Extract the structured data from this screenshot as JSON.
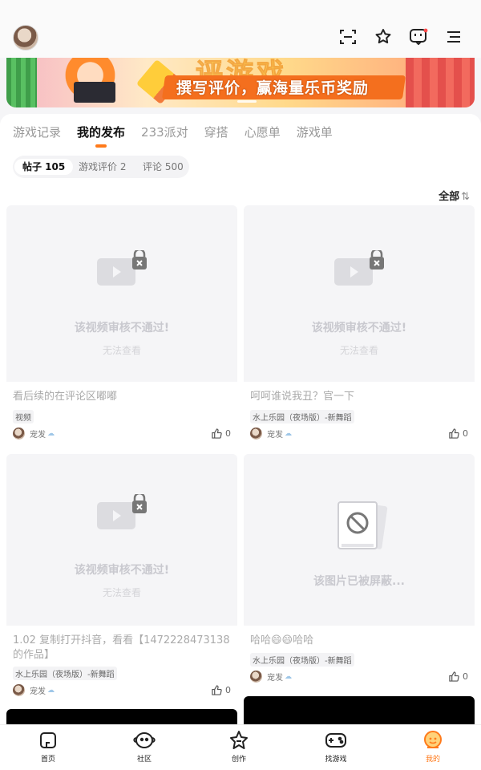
{
  "header": {
    "icons": [
      "scan-icon",
      "star-badge-icon",
      "message-icon",
      "menu-icon"
    ]
  },
  "banner": {
    "headline": "评游戏",
    "text": "撰写评价，赢海量乐币奖励"
  },
  "tabs": [
    {
      "label": "游戏记录"
    },
    {
      "label": "我的发布"
    },
    {
      "label": "233派对"
    },
    {
      "label": "穿搭"
    },
    {
      "label": "心愿单"
    },
    {
      "label": "游戏单"
    }
  ],
  "subtabs": [
    {
      "label": "帖子 105"
    },
    {
      "label": "游戏评价 2"
    },
    {
      "label": "评论 500"
    }
  ],
  "filter": {
    "label": "全部",
    "arrow": "⇅"
  },
  "cards": [
    {
      "blocked_title": "该视频审核不通过!",
      "blocked_sub": "无法查看",
      "title": "看后续的在评论区嘟嘟",
      "tag": "视频",
      "author": "宠发",
      "likes": "0"
    },
    {
      "blocked_title": "该视频审核不通过!",
      "blocked_sub": "无法查看",
      "title": "呵呵谁说我丑？官一下",
      "tag": "水上乐园（夜场版）-新舞蹈",
      "author": "宠发",
      "likes": "0"
    },
    {
      "blocked_title": "该视频审核不通过!",
      "blocked_sub": "无法查看",
      "title": "1.02 复制打开抖音，看看【1472228473138的作品】",
      "tag": "水上乐园（夜场版）-新舞蹈",
      "author": "宠发",
      "likes": "0"
    },
    {
      "blocked_title": "该图片已被屏蔽...",
      "title": "哈哈😄😄哈哈",
      "tag": "水上乐园（夜场版）-新舞蹈",
      "author": "宠发",
      "likes": "0"
    }
  ],
  "nav": [
    {
      "label": "首页",
      "icon": "home-icon"
    },
    {
      "label": "社区",
      "icon": "community-icon"
    },
    {
      "label": "创作",
      "icon": "create-icon"
    },
    {
      "label": "找游戏",
      "icon": "gamepad-icon"
    },
    {
      "label": "我的",
      "icon": "profile-icon"
    }
  ],
  "colors": {
    "accent": "#ff7a1a",
    "muted": "#c9c9cf"
  }
}
